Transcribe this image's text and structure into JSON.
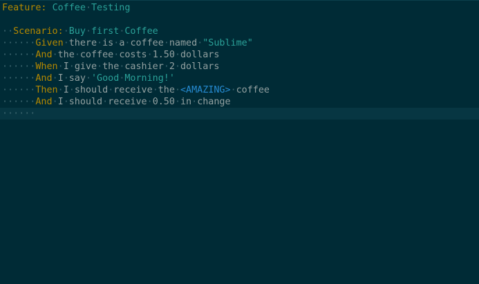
{
  "editor": {
    "colors": {
      "background": "#002b36",
      "current_line": "#073642",
      "keyword": "#b58900",
      "title": "#2aa198",
      "string": "#2aa198",
      "outline_param": "#268bd2",
      "text": "#93a1a1",
      "whitespace_marker": "#3e6770"
    },
    "lines": [
      {
        "tokens": [
          {
            "type": "kw-feature",
            "text": "Feature:"
          },
          {
            "type": "ws",
            "text": " "
          },
          {
            "type": "title",
            "text": "Coffee"
          },
          {
            "type": "ws",
            "text": "·"
          },
          {
            "type": "title",
            "text": "Testing"
          }
        ]
      },
      {
        "tokens": []
      },
      {
        "tokens": [
          {
            "type": "ws",
            "text": "··"
          },
          {
            "type": "kw-feature",
            "text": "Scenario:"
          },
          {
            "type": "ws",
            "text": "·"
          },
          {
            "type": "title",
            "text": "Buy"
          },
          {
            "type": "ws",
            "text": "·"
          },
          {
            "type": "title",
            "text": "first"
          },
          {
            "type": "ws",
            "text": "·"
          },
          {
            "type": "title",
            "text": "Coffee"
          }
        ]
      },
      {
        "tokens": [
          {
            "type": "ws",
            "text": "······"
          },
          {
            "type": "kw-step",
            "text": "Given"
          },
          {
            "type": "ws",
            "text": "·"
          },
          {
            "type": "plain",
            "text": "there"
          },
          {
            "type": "ws",
            "text": "·"
          },
          {
            "type": "plain",
            "text": "is"
          },
          {
            "type": "ws",
            "text": "·"
          },
          {
            "type": "plain",
            "text": "a"
          },
          {
            "type": "ws",
            "text": "·"
          },
          {
            "type": "plain",
            "text": "coffee"
          },
          {
            "type": "ws",
            "text": "·"
          },
          {
            "type": "plain",
            "text": "named"
          },
          {
            "type": "ws",
            "text": "·"
          },
          {
            "type": "str-dq",
            "text": "\"Sublime\""
          }
        ]
      },
      {
        "tokens": [
          {
            "type": "ws",
            "text": "······"
          },
          {
            "type": "kw-step",
            "text": "And"
          },
          {
            "type": "ws",
            "text": "·"
          },
          {
            "type": "plain",
            "text": "the"
          },
          {
            "type": "ws",
            "text": "·"
          },
          {
            "type": "plain",
            "text": "coffee"
          },
          {
            "type": "ws",
            "text": "·"
          },
          {
            "type": "plain",
            "text": "costs"
          },
          {
            "type": "ws",
            "text": "·"
          },
          {
            "type": "num",
            "text": "1.50"
          },
          {
            "type": "ws",
            "text": "·"
          },
          {
            "type": "plain",
            "text": "dollars"
          }
        ]
      },
      {
        "tokens": [
          {
            "type": "ws",
            "text": "······"
          },
          {
            "type": "kw-step",
            "text": "When"
          },
          {
            "type": "ws",
            "text": "·"
          },
          {
            "type": "plain",
            "text": "I"
          },
          {
            "type": "ws",
            "text": "·"
          },
          {
            "type": "plain",
            "text": "give"
          },
          {
            "type": "ws",
            "text": "·"
          },
          {
            "type": "plain",
            "text": "the"
          },
          {
            "type": "ws",
            "text": "·"
          },
          {
            "type": "plain",
            "text": "cashier"
          },
          {
            "type": "ws",
            "text": "·"
          },
          {
            "type": "num",
            "text": "2"
          },
          {
            "type": "ws",
            "text": "·"
          },
          {
            "type": "plain",
            "text": "dollars"
          }
        ]
      },
      {
        "tokens": [
          {
            "type": "ws",
            "text": "······"
          },
          {
            "type": "kw-step",
            "text": "And"
          },
          {
            "type": "ws",
            "text": "·"
          },
          {
            "type": "plain",
            "text": "I"
          },
          {
            "type": "ws",
            "text": "·"
          },
          {
            "type": "plain",
            "text": "say"
          },
          {
            "type": "ws",
            "text": "·"
          },
          {
            "type": "str-sq",
            "text": "'Good"
          },
          {
            "type": "ws",
            "text": "·"
          },
          {
            "type": "str-sq",
            "text": "Morning!'"
          }
        ]
      },
      {
        "tokens": [
          {
            "type": "ws",
            "text": "······"
          },
          {
            "type": "kw-step",
            "text": "Then"
          },
          {
            "type": "ws",
            "text": "·"
          },
          {
            "type": "plain",
            "text": "I"
          },
          {
            "type": "ws",
            "text": "·"
          },
          {
            "type": "plain",
            "text": "should"
          },
          {
            "type": "ws",
            "text": "·"
          },
          {
            "type": "plain",
            "text": "receive"
          },
          {
            "type": "ws",
            "text": "·"
          },
          {
            "type": "plain",
            "text": "the"
          },
          {
            "type": "ws",
            "text": "·"
          },
          {
            "type": "outline-param",
            "text": "<AMAZING>"
          },
          {
            "type": "ws",
            "text": "·"
          },
          {
            "type": "plain",
            "text": "coffee"
          }
        ]
      },
      {
        "tokens": [
          {
            "type": "ws",
            "text": "······"
          },
          {
            "type": "kw-step",
            "text": "And"
          },
          {
            "type": "ws",
            "text": "·"
          },
          {
            "type": "plain",
            "text": "I"
          },
          {
            "type": "ws",
            "text": "·"
          },
          {
            "type": "plain",
            "text": "should"
          },
          {
            "type": "ws",
            "text": "·"
          },
          {
            "type": "plain",
            "text": "receive"
          },
          {
            "type": "ws",
            "text": "·"
          },
          {
            "type": "num",
            "text": "0.50"
          },
          {
            "type": "ws",
            "text": "·"
          },
          {
            "type": "plain",
            "text": "in"
          },
          {
            "type": "ws",
            "text": "·"
          },
          {
            "type": "plain",
            "text": "change"
          }
        ]
      },
      {
        "current": true,
        "tokens": [
          {
            "type": "ws",
            "text": "······"
          }
        ]
      }
    ]
  }
}
